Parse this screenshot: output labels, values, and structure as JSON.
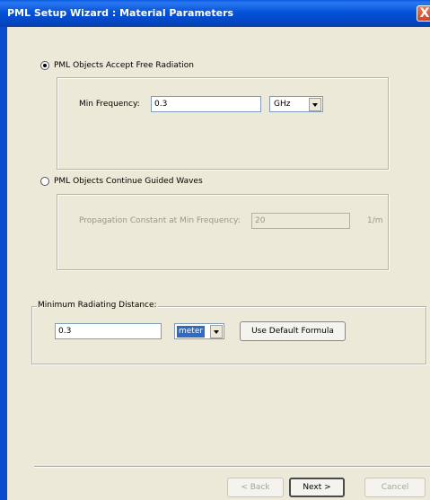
{
  "window": {
    "title": "PML Setup Wizard : Material Parameters",
    "close_glyph": "X"
  },
  "option_free_radiation": {
    "label": "PML Objects Accept Free Radiation",
    "selected": true
  },
  "min_frequency": {
    "label": "Min Frequency:",
    "value": "0.3",
    "unit": "GHz"
  },
  "option_guided_waves": {
    "label": "PML Objects Continue Guided Waves",
    "selected": false
  },
  "propagation": {
    "label": "Propagation Constant at Min Frequency:",
    "value": "20",
    "unit": "1/m"
  },
  "min_radiating_distance": {
    "group_label": "Minimum Radiating Distance:",
    "value": "0.3",
    "unit": "meter",
    "default_button": "Use Default Formula"
  },
  "nav": {
    "back": "< Back",
    "next": "Next >",
    "cancel": "Cancel"
  },
  "colors": {
    "titlebar": "#0552d8",
    "dialog_bg": "#ece9d8",
    "selection": "#316ac5",
    "close": "#d2431f"
  }
}
